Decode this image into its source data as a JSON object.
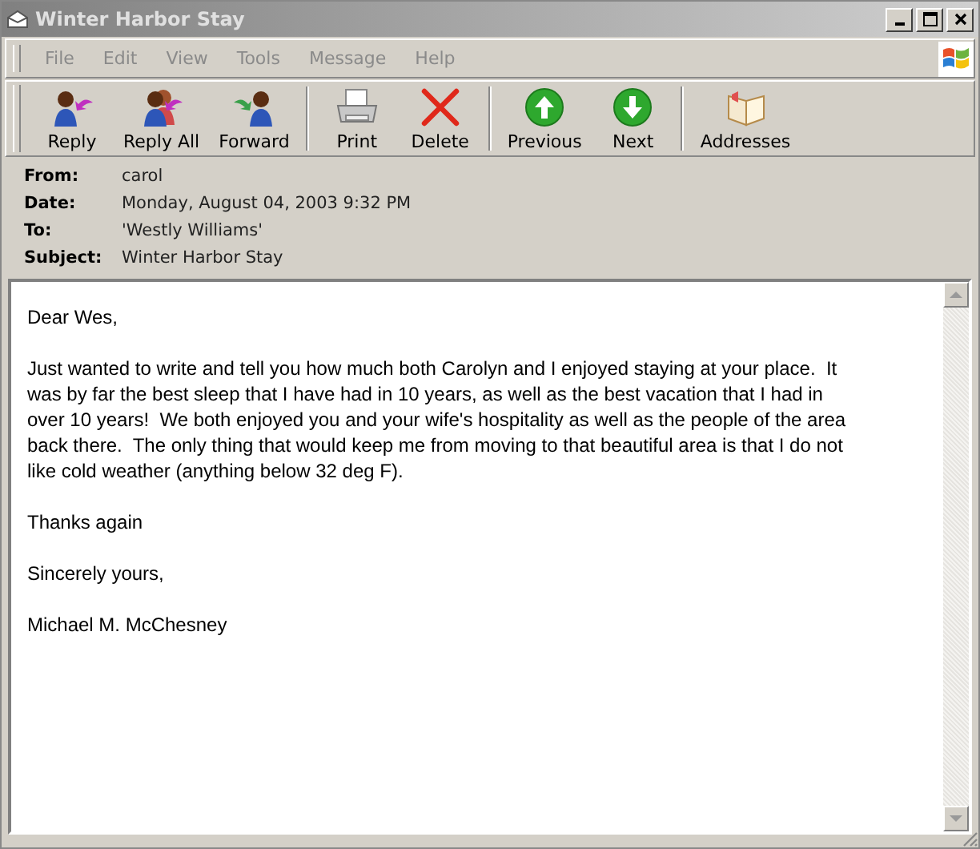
{
  "window": {
    "title": "Winter Harbor Stay",
    "active": false
  },
  "menu": [
    {
      "label": "File"
    },
    {
      "label": "Edit"
    },
    {
      "label": "View"
    },
    {
      "label": "Tools"
    },
    {
      "label": "Message"
    },
    {
      "label": "Help"
    }
  ],
  "toolbar": [
    {
      "buttons": [
        {
          "label": "Reply",
          "kind": "reply"
        },
        {
          "label": "Reply All",
          "kind": "reply-all"
        },
        {
          "label": "Forward",
          "kind": "forward"
        }
      ]
    },
    {
      "buttons": [
        {
          "label": "Print",
          "kind": "print"
        },
        {
          "label": "Delete",
          "kind": "delete"
        }
      ]
    },
    {
      "buttons": [
        {
          "label": "Previous",
          "kind": "previous"
        },
        {
          "label": "Next",
          "kind": "next"
        }
      ]
    },
    {
      "buttons": [
        {
          "label": "Addresses",
          "kind": "addresses"
        }
      ]
    }
  ],
  "headers": [
    {
      "label": "From:",
      "value": "carol"
    },
    {
      "label": "Date:",
      "value": "Monday, August 04, 2003 9:32 PM"
    },
    {
      "label": "To:",
      "value": "'Westly Williams'"
    },
    {
      "label": "Subject:",
      "value": "Winter Harbor Stay"
    }
  ],
  "body": [
    [
      "Dear Wes,"
    ],
    [
      "Just wanted to write and tell you how much both Carolyn and I enjoyed staying at your place.  It",
      "was by far the best sleep that I have had in 10 years, as well as the best vacation that I had in",
      "over 10 years!  We both enjoyed you and your wife's hospitality as well as the people of the area",
      "back there.  The only thing that would keep me from moving to that beautiful area is that I do not",
      "like cold weather (anything below 32 deg F)."
    ],
    [
      "Thanks again"
    ],
    [
      "Sincerely yours,"
    ],
    [
      "Michael M. McChesney"
    ]
  ]
}
